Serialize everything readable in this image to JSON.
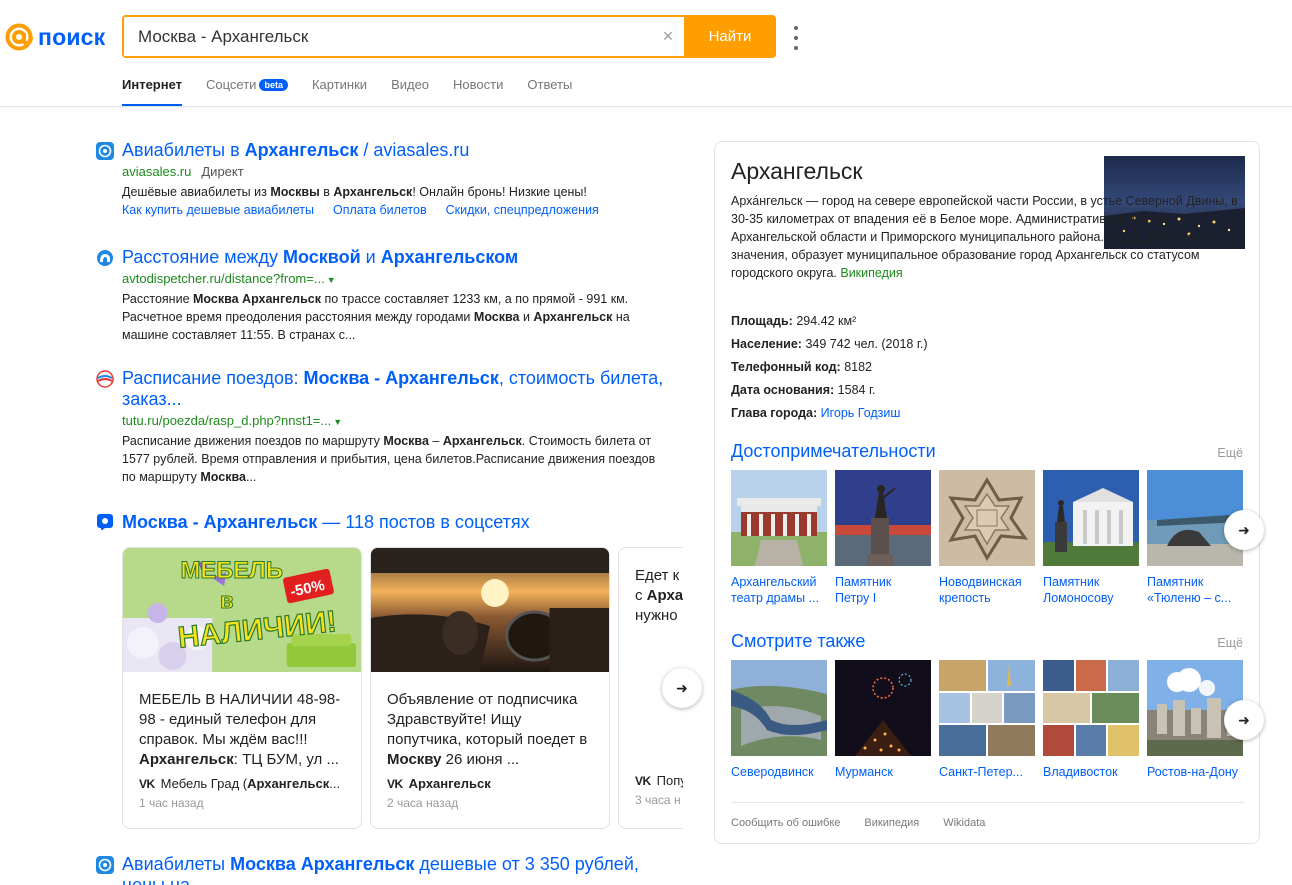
{
  "header": {
    "logo_text": "поиск",
    "search_value": "Москва - Архангельск",
    "clear_icon": "×",
    "search_button": "Найти",
    "brand_color": "#005ff9",
    "accent_color": "#ff9e00"
  },
  "tabs": [
    {
      "label": "Интернет",
      "active": true
    },
    {
      "label": "Соцсети",
      "badge": "beta"
    },
    {
      "label": "Картинки"
    },
    {
      "label": "Видео"
    },
    {
      "label": "Новости"
    },
    {
      "label": "Ответы"
    }
  ],
  "results": [
    {
      "icon": "aviasales-icon",
      "title_pre": "Авиабилеты в ",
      "title_bold": "Архангельск",
      "title_post": " / aviasales.ru",
      "url": "aviasales.ru",
      "direct": "Директ",
      "snippet": [
        "Дешёвые авиабилеты из ",
        "Москвы",
        " в ",
        "Архангельск",
        "! Онлайн бронь! Низкие цены!"
      ],
      "links": [
        "Как купить дешевые авиабилеты",
        "Оплата билетов",
        "Скидки, спецпредложения"
      ]
    },
    {
      "icon": "avtodispetcher-icon",
      "title_pre": "Расстояние между ",
      "title_bold": "Москвой",
      "title_mid": " и ",
      "title_bold2": "Архангельском",
      "url": "avtodispetcher.ru/distance?from=...",
      "snippet_line1_pre": "Расстояние ",
      "snippet_line1_bold": "Москва Архангельск",
      "snippet_line1_post": " по трассе составляет 1233 км, а по прямой - 991 км.",
      "snippet_line2_pre": "Расчетное время преодоления расстояния между городами ",
      "snippet_line2_bold1": "Москва",
      "snippet_line2_mid": " и ",
      "snippet_line2_bold2": "Архангельск",
      "snippet_line2_post": " на",
      "snippet_line3": "машине составляет 11:55. В странах с..."
    },
    {
      "icon": "tutu-icon",
      "title_pre": "Расписание поездов: ",
      "title_bold": "Москва - Архангельск",
      "title_post": ", стоимость билета,",
      "title_line2": "заказ...",
      "url": "tutu.ru/poezda/rasp_d.php?nnst1=...",
      "snippet_line1_pre": "Расписание движения поездов по маршруту ",
      "snippet_line1_bold1": "Москва",
      "snippet_line1_mid": " – ",
      "snippet_line1_bold2": "Архангельск",
      "snippet_line1_post": ". Стоимость билета от",
      "snippet_line2": "1577 рублей. Время отправления и прибытия, цена билетов.Расписание движения поездов",
      "snippet_line3_pre": "по маршруту ",
      "snippet_line3_bold": "Москва",
      "snippet_line3_post": "..."
    }
  ],
  "social": {
    "title_bold": "Москва - Архангельск",
    "title_post": " — 118 постов в соцсетях",
    "cards": [
      {
        "image_text_1": "МЕБЕЛЬ",
        "image_text_2": "в",
        "image_text_3": "НАЛИЧИИ!",
        "image_badge": "-50%",
        "text_pre": "МЕБЕЛЬ В НАЛИЧИИ 48-98-98 - единый телефон для справок. Мы ждём вас!!! ",
        "text_bold": "Архангельск",
        "text_post": ": ТЦ БУМ, ул ...",
        "source_pre": "Мебель Град (",
        "source_bold": "Архангельск",
        "source_post": "...",
        "time": "1 час назад"
      },
      {
        "text_pre": "Объявление от подписчика Здравствуйте! Ищу попутчика, который поедет в ",
        "text_bold": "Москву",
        "text_post": " 26 июня ...",
        "source_pre": "",
        "source_bold": "Архангельск",
        "source_post": "",
        "time": "2 часа назад"
      },
      {
        "text_line1": "Едет к",
        "text_line2_pre": "с ",
        "text_line2_bold": "Арха",
        "text_line3": "нужно",
        "source_pre": "Попу",
        "time": "3 часа н"
      }
    ],
    "vk_label": "VK",
    "arrow": "➜"
  },
  "last_result": {
    "title_pre": "Авиабилеты ",
    "title_bold": "Москва Архангельск",
    "title_post": " дешевые от 3 350 рублей,",
    "title_line2": "цены на..."
  },
  "knowledge": {
    "title": "Архангельск",
    "desc": "Арха́нгельск — город на севере европейской части России, в устье Северной Двины, в 30-35 километрах от впадения её в Белое море. Административный центр Архангельской области и Приморского муниципального района. Город областного значения, образует муниципальное образование город Архангельск со статусом городского округа. ",
    "desc_source": "Википедия",
    "facts": [
      {
        "label": "Площадь:",
        "value": "294.42 км²"
      },
      {
        "label": "Население:",
        "value": "349 742 чел. (2018 г.)"
      },
      {
        "label": "Телефонный код:",
        "value": "8182"
      },
      {
        "label": "Дата основания:",
        "value": "1584 г."
      },
      {
        "label": "Глава города:",
        "value": "Игорь Годзиш",
        "link": true
      }
    ],
    "sights_title": "Достопримечательности",
    "sights_more": "Ещё",
    "sights": [
      {
        "l1": "Архангельский",
        "l2": "театр драмы ..."
      },
      {
        "l1": "Памятник",
        "l2": "Петру I"
      },
      {
        "l1": "Новодвинская",
        "l2": "крепость"
      },
      {
        "l1": "Памятник",
        "l2": "Ломоносову"
      },
      {
        "l1": "Памятник",
        "l2": "«Тюленю – с..."
      }
    ],
    "related_title": "Смотрите также",
    "related_more": "Ещё",
    "related": [
      {
        "l1": "Северодвинск"
      },
      {
        "l1": "Мурманск"
      },
      {
        "l1": "Санкт-Петер..."
      },
      {
        "l1": "Владивосток"
      },
      {
        "l1": "Ростов-на-Дону"
      }
    ],
    "footer": [
      "Сообщить об ошибке",
      "Википедия",
      "Wikidata"
    ],
    "arrow": "➜"
  }
}
